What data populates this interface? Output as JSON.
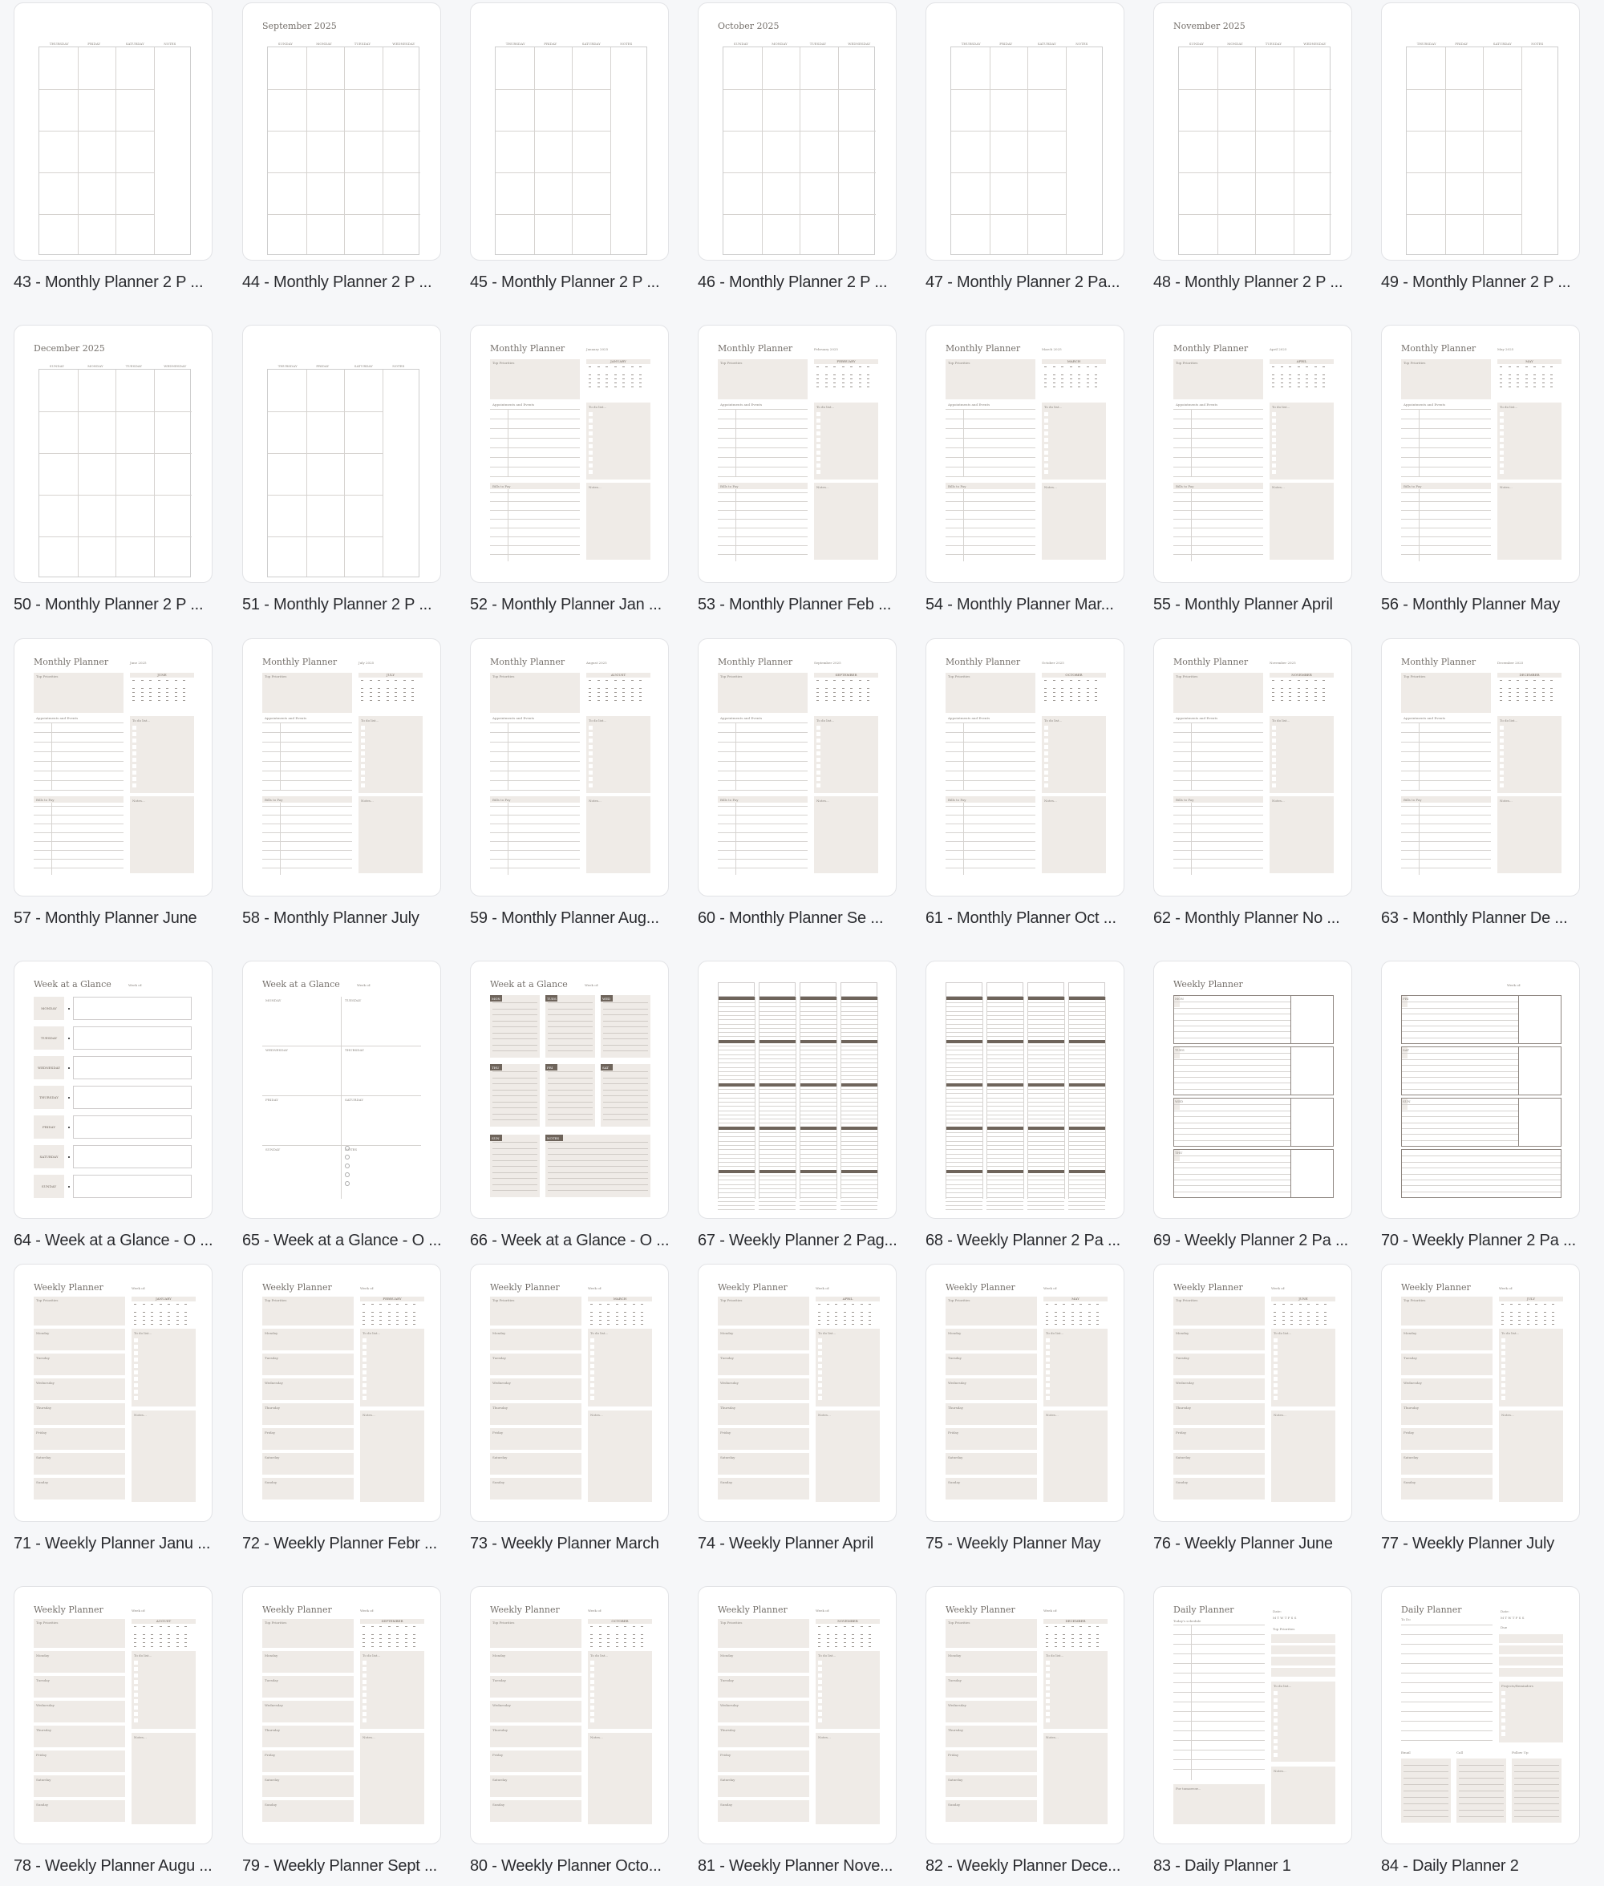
{
  "pages": [
    {
      "num": 43,
      "caption": "43 - Monthly Planner 2 P ...",
      "type": "monthly-right"
    },
    {
      "num": 44,
      "caption": "44 - Monthly Planner 2 P ...",
      "type": "monthly-left",
      "month_title": "September 2025"
    },
    {
      "num": 45,
      "caption": "45 - Monthly Planner 2 P ...",
      "type": "monthly-right"
    },
    {
      "num": 46,
      "caption": "46 - Monthly Planner 2 P ...",
      "type": "monthly-left",
      "month_title": "October 2025"
    },
    {
      "num": 47,
      "caption": "47 - Monthly Planner 2 Pa...",
      "type": "monthly-right"
    },
    {
      "num": 48,
      "caption": "48 - Monthly Planner 2 P ...",
      "type": "monthly-left",
      "month_title": "November 2025"
    },
    {
      "num": 49,
      "caption": "49 - Monthly Planner 2 P ...",
      "type": "monthly-right"
    },
    {
      "num": 50,
      "caption": "50 - Monthly Planner 2 P ...",
      "type": "monthly-left",
      "month_title": "December 2025"
    },
    {
      "num": 51,
      "caption": "51 - Monthly Planner 2 P ...",
      "type": "monthly-right"
    },
    {
      "num": 52,
      "caption": "52 - Monthly Planner Jan ...",
      "type": "monthly-full",
      "month": "JANUARY"
    },
    {
      "num": 53,
      "caption": "53 - Monthly Planner Feb ...",
      "type": "monthly-full",
      "month": "FEBRUARY"
    },
    {
      "num": 54,
      "caption": "54 - Monthly Planner Mar...",
      "type": "monthly-full",
      "month": "MARCH"
    },
    {
      "num": 55,
      "caption": "55 - Monthly Planner April",
      "type": "monthly-full",
      "month": "APRIL"
    },
    {
      "num": 56,
      "caption": "56 - Monthly Planner May",
      "type": "monthly-full",
      "month": "MAY"
    },
    {
      "num": 57,
      "caption": "57 - Monthly Planner June",
      "type": "monthly-full",
      "month": "JUNE"
    },
    {
      "num": 58,
      "caption": "58 - Monthly Planner July",
      "type": "monthly-full",
      "month": "JULY"
    },
    {
      "num": 59,
      "caption": "59 - Monthly Planner Aug...",
      "type": "monthly-full",
      "month": "AUGUST"
    },
    {
      "num": 60,
      "caption": "60 - Monthly Planner Se ...",
      "type": "monthly-full",
      "month": "SEPTEMBER"
    },
    {
      "num": 61,
      "caption": "61 - Monthly Planner Oct ...",
      "type": "monthly-full",
      "month": "OCTOBER"
    },
    {
      "num": 62,
      "caption": "62 - Monthly Planner No ...",
      "type": "monthly-full",
      "month": "NOVEMBER"
    },
    {
      "num": 63,
      "caption": "63 - Monthly Planner De ...",
      "type": "monthly-full",
      "month": "DECEMBER"
    },
    {
      "num": 64,
      "caption": "64 - Week at a Glance - O ...",
      "type": "wag-list"
    },
    {
      "num": 65,
      "caption": "65 - Week at a Glance - O ...",
      "type": "wag-quad"
    },
    {
      "num": 66,
      "caption": "66 - Week at a Glance - O ...",
      "type": "wag-boxes"
    },
    {
      "num": 67,
      "caption": "67 - Weekly Planner 2 Pag...",
      "type": "weekly-columns"
    },
    {
      "num": 68,
      "caption": "68 - Weekly Planner 2 Pa ...",
      "type": "weekly-columns"
    },
    {
      "num": 69,
      "caption": "69 - Weekly Planner 2 Pa ...",
      "type": "weekly-blocks-left"
    },
    {
      "num": 70,
      "caption": "70 - Weekly Planner 2 Pa ...",
      "type": "weekly-blocks-right"
    },
    {
      "num": 71,
      "caption": "71 - Weekly Planner Janu ...",
      "type": "weekly-full",
      "month": "JANUARY"
    },
    {
      "num": 72,
      "caption": "72 - Weekly Planner Febr ...",
      "type": "weekly-full",
      "month": "FEBRUARY"
    },
    {
      "num": 73,
      "caption": "73 - Weekly Planner March",
      "type": "weekly-full",
      "month": "MARCH"
    },
    {
      "num": 74,
      "caption": "74 - Weekly Planner April",
      "type": "weekly-full",
      "month": "APRIL"
    },
    {
      "num": 75,
      "caption": "75 - Weekly Planner May",
      "type": "weekly-full",
      "month": "MAY"
    },
    {
      "num": 76,
      "caption": "76 - Weekly Planner June",
      "type": "weekly-full",
      "month": "JUNE"
    },
    {
      "num": 77,
      "caption": "77 - Weekly Planner July",
      "type": "weekly-full",
      "month": "JULY"
    },
    {
      "num": 78,
      "caption": "78 - Weekly Planner Augu ...",
      "type": "weekly-full",
      "month": "AUGUST"
    },
    {
      "num": 79,
      "caption": "79 - Weekly Planner Sept ...",
      "type": "weekly-full",
      "month": "SEPTEMBER"
    },
    {
      "num": 80,
      "caption": "80 - Weekly Planner Octo...",
      "type": "weekly-full",
      "month": "OCTOBER"
    },
    {
      "num": 81,
      "caption": "81 - Weekly Planner Nove...",
      "type": "weekly-full",
      "month": "NOVEMBER"
    },
    {
      "num": 82,
      "caption": "82 - Weekly Planner Dece...",
      "type": "weekly-full",
      "month": "DECEMBER"
    },
    {
      "num": 83,
      "caption": "83 - Daily Planner 1",
      "type": "daily-1"
    },
    {
      "num": 84,
      "caption": "84 - Daily Planner 2",
      "type": "daily-2"
    }
  ],
  "labels": {
    "monthly_planner": "Monthly Planner",
    "weekly_planner": "Weekly Planner",
    "week_at_a_glance": "Week at a Glance",
    "daily_planner": "Daily Planner",
    "week_of": "Week of:",
    "top_priorities": "Top Priorities",
    "appointments": "Appointments and Events",
    "bills": "Bills to Pay",
    "todo": "To do list...",
    "notes": "Notes...",
    "todays_schedule": "Today's schedule",
    "for_tomorrow": "For tomorrow...",
    "date": "Date:",
    "projects": "Projects/Reminders",
    "email": "Email",
    "call": "Call",
    "follow_up": "Follow Up",
    "left_days": [
      "SUNDAY",
      "MONDAY",
      "TUESDAY",
      "WEDNESDAY"
    ],
    "right_days": [
      "THURSDAY",
      "FRIDAY",
      "SATURDAY",
      "NOTES"
    ],
    "wag_days": [
      "MONDAY",
      "TUESDAY",
      "WEDNESDAY",
      "THURSDAY",
      "FRIDAY",
      "SATURDAY",
      "SUNDAY"
    ],
    "wag_short": [
      "MON",
      "TUES",
      "WED",
      "THU",
      "FRI",
      "SAT",
      "SUN",
      "NOTES"
    ],
    "weekly_days": [
      "Monday",
      "Tuesday",
      "Wednesday",
      "Thursday",
      "Friday",
      "Saturday",
      "Sunday"
    ],
    "block_days_left": [
      "MON",
      "TUES",
      "WED",
      "THU"
    ],
    "block_days_right": [
      "FRI",
      "SAT",
      "SUN"
    ]
  }
}
